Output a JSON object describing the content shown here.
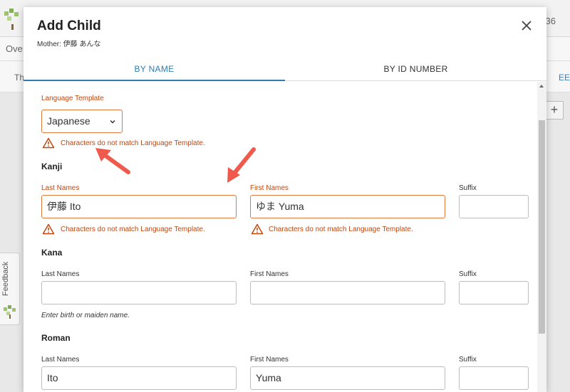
{
  "background": {
    "top_right_text": "36",
    "row1_text": "Ove",
    "row2_text": "Th",
    "row2_right_text": "EE",
    "plus_label": "+",
    "feedback_label": "Feedback"
  },
  "modal": {
    "title": "Add Child",
    "subtitle": "Mother: 伊藤 あんな",
    "tabs": [
      {
        "label": "BY NAME",
        "active": true
      },
      {
        "label": "BY ID NUMBER",
        "active": false
      }
    ]
  },
  "form": {
    "language_template": {
      "label": "Language Template",
      "value": "Japanese",
      "error": "Characters do not match Language Template."
    },
    "kanji": {
      "title": "Kanji",
      "last_names_label": "Last Names",
      "last_names_value": "伊藤 Ito",
      "last_names_error": "Characters do not match Language Template.",
      "first_names_label": "First Names",
      "first_names_value": "ゆま Yuma",
      "first_names_error": "Characters do not match Language Template.",
      "suffix_label": "Suffix",
      "suffix_value": ""
    },
    "kana": {
      "title": "Kana",
      "last_names_label": "Last Names",
      "last_names_value": "",
      "first_names_label": "First Names",
      "first_names_value": "",
      "suffix_label": "Suffix",
      "suffix_value": "",
      "hint": "Enter birth or maiden name."
    },
    "roman": {
      "title": "Roman",
      "last_names_label": "Last Names",
      "last_names_value": "Ito",
      "first_names_label": "First Names",
      "first_names_value": "Yuma",
      "suffix_label": "Suffix",
      "suffix_value": ""
    }
  },
  "colors": {
    "accent": "#2d7db3",
    "error": "#c0470f",
    "error_border": "#e07a3f",
    "annotation_arrow": "#ef5a4c"
  }
}
